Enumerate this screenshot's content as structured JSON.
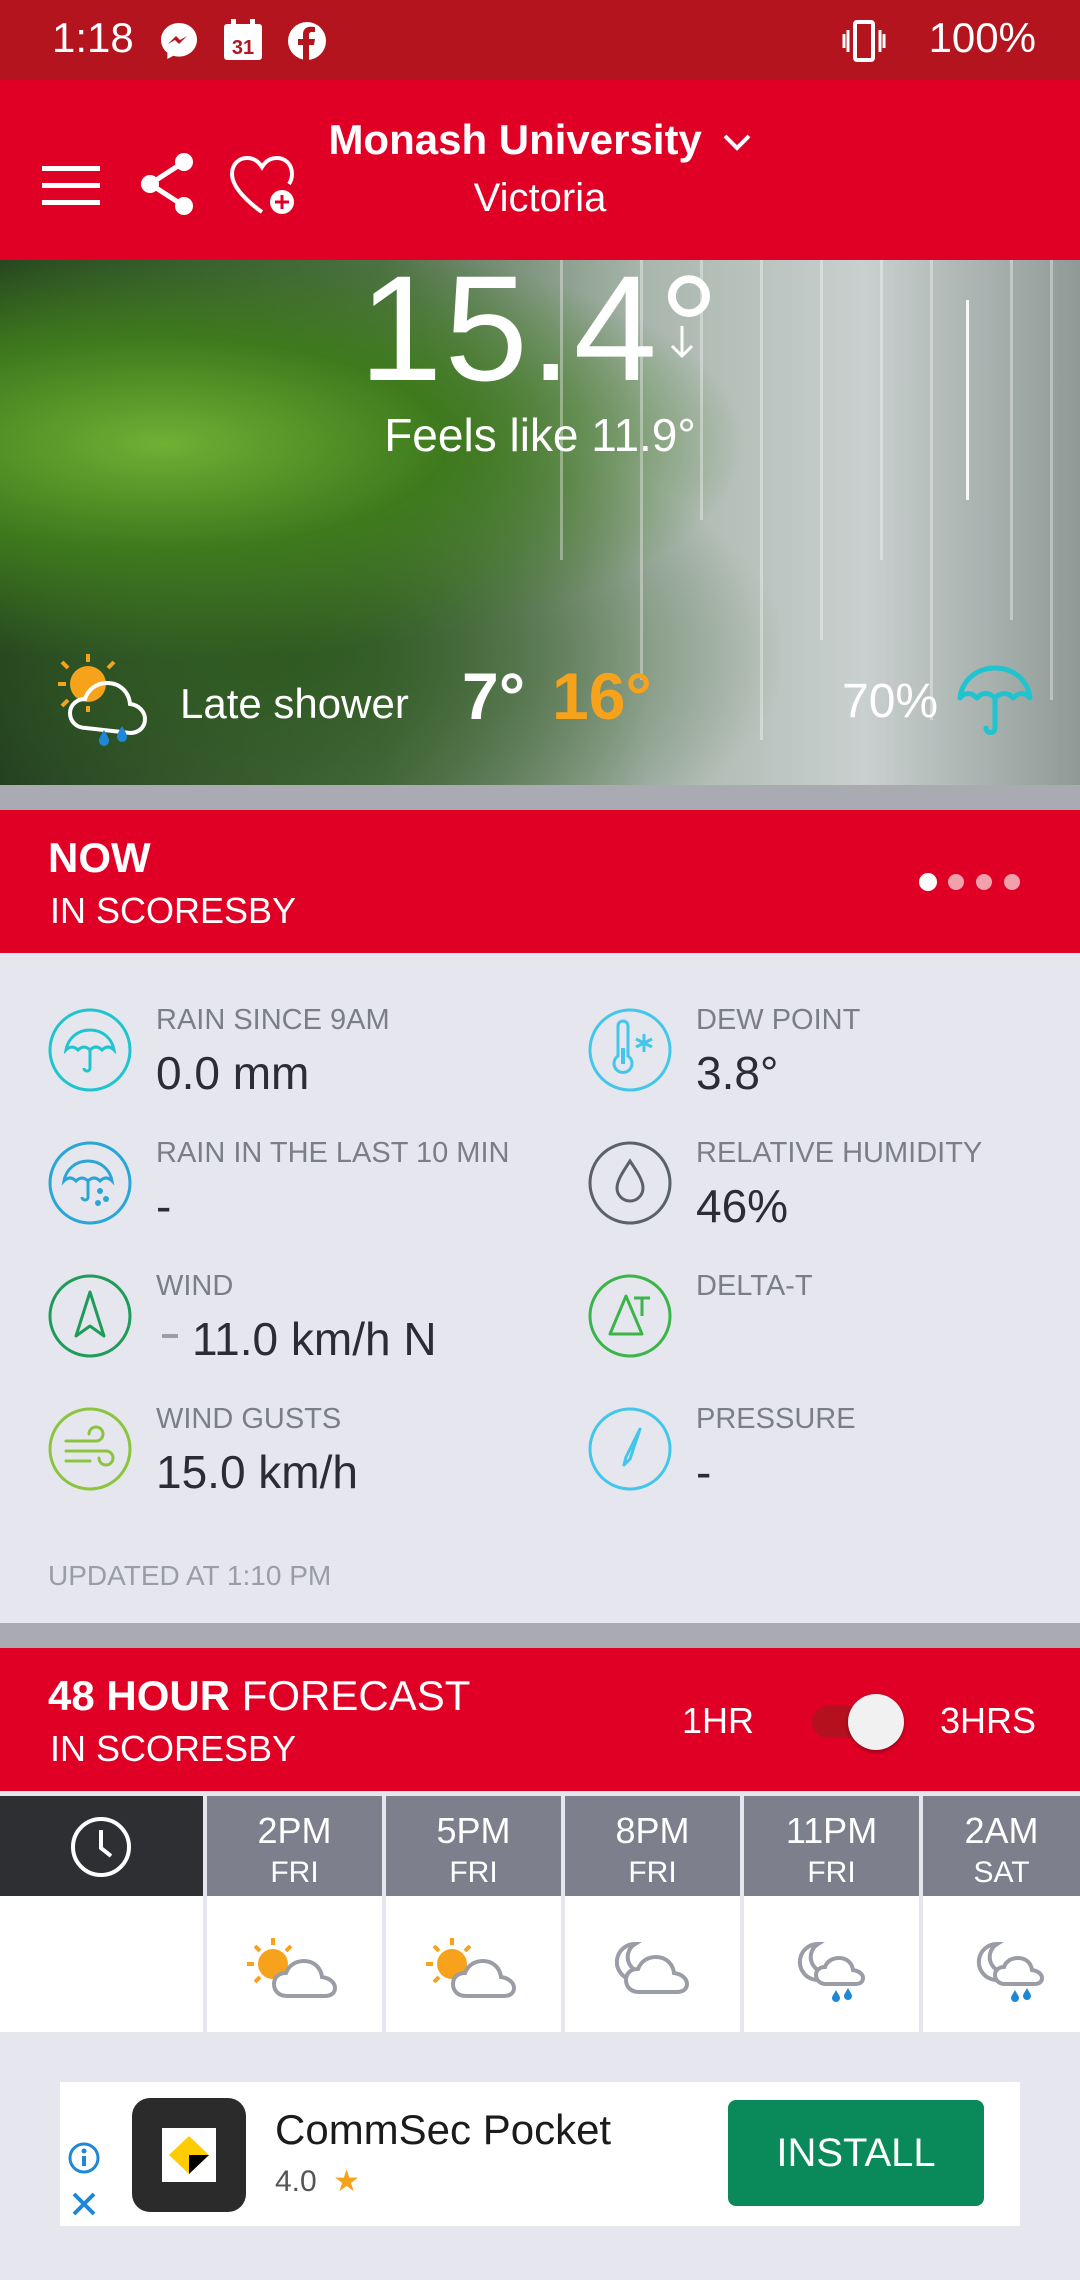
{
  "status_bar": {
    "time": "1:18",
    "battery": "100%",
    "calendar_day": "31"
  },
  "header": {
    "location": "Monash University",
    "region": "Victoria"
  },
  "current": {
    "temperature": "15.4°",
    "feels_like": "Feels like 11.9°",
    "condition": "Late shower",
    "min": "7°",
    "max": "16°",
    "rain_chance": "70%"
  },
  "now": {
    "title": "NOW",
    "subtitle": "IN SCORESBY",
    "observations": [
      {
        "label": "RAIN SINCE 9AM",
        "value": "0.0 mm",
        "icon": "umbrella-icon",
        "color": "#1fc4cf"
      },
      {
        "label": "DEW POINT",
        "value": "3.8°",
        "icon": "thermometer-icon",
        "color": "#44c6ea"
      },
      {
        "label": "RAIN IN THE LAST 10 MIN",
        "value": "-",
        "icon": "umbrella-rain-icon",
        "color": "#2aa6d6"
      },
      {
        "label": "RELATIVE HUMIDITY",
        "value": "46%",
        "icon": "droplet-icon",
        "color": "#5c6169"
      },
      {
        "label": "WIND",
        "value": "11.0 km/h N",
        "icon": "wind-direction-icon",
        "color": "#1f9b5a"
      },
      {
        "label": "DELTA-T",
        "value": "",
        "icon": "delta-t-icon",
        "color": "#3bb54a"
      },
      {
        "label": "WIND GUSTS",
        "value": "15.0 km/h",
        "icon": "wind-gust-icon",
        "color": "#8bc43f"
      },
      {
        "label": "PRESSURE",
        "value": "-",
        "icon": "pressure-gauge-icon",
        "color": "#44c6ea"
      }
    ],
    "updated": "UPDATED AT 1:10 PM"
  },
  "forecast": {
    "title_bold": "48 HOUR",
    "title_rest": " FORECAST",
    "subtitle": "IN SCORESBY",
    "toggle_left": "1HR",
    "toggle_right": "3HRS",
    "columns": [
      {
        "time": "2PM",
        "day": "FRI",
        "icon": "partly-cloudy-day-icon"
      },
      {
        "time": "5PM",
        "day": "FRI",
        "icon": "partly-cloudy-day-icon"
      },
      {
        "time": "8PM",
        "day": "FRI",
        "icon": "cloudy-night-icon"
      },
      {
        "time": "11PM",
        "day": "FRI",
        "icon": "night-shower-icon"
      },
      {
        "time": "2AM",
        "day": "SAT",
        "icon": "night-shower-icon"
      }
    ]
  },
  "ad": {
    "app_name": "CommSec Pocket",
    "rating": "4.0",
    "install_label": "INSTALL"
  },
  "colors": {
    "brand_red": "#e00025",
    "status_red": "#b3141e",
    "accent_orange": "#f7a21b",
    "install_green": "#0a8a5b"
  }
}
